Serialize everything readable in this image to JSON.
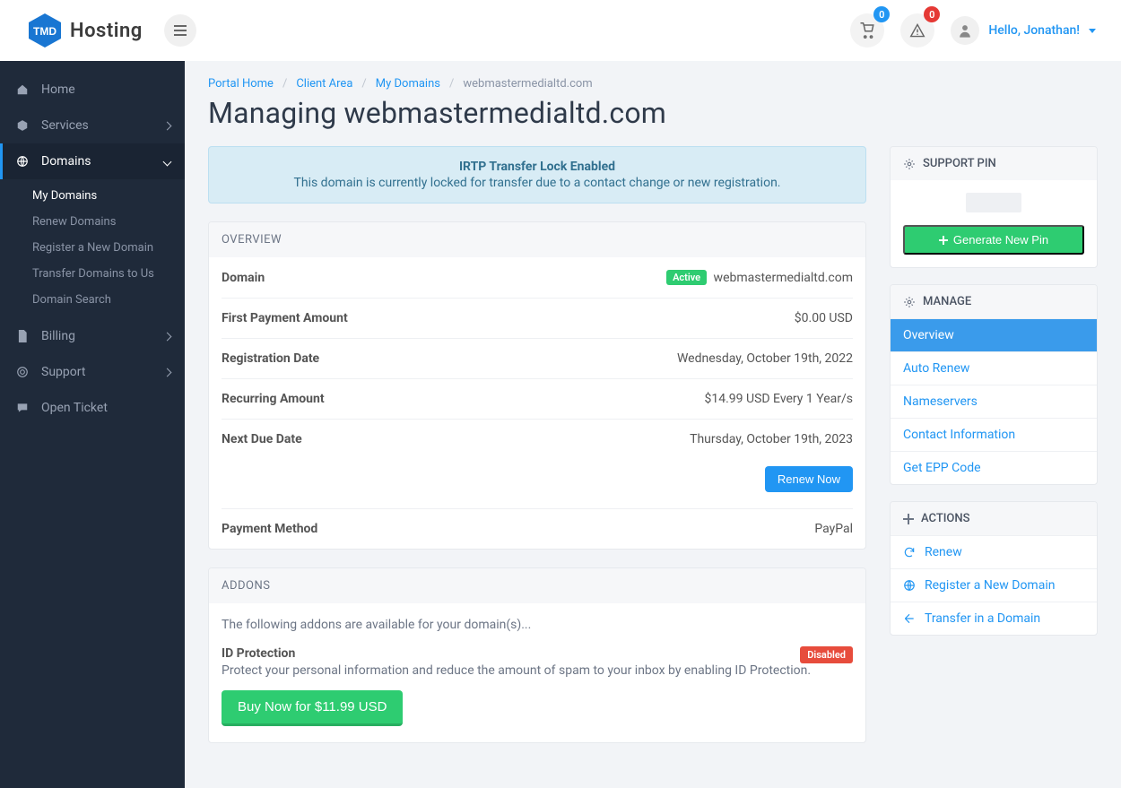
{
  "brand": {
    "name": "Hosting",
    "prefix": "TMD"
  },
  "header": {
    "cart_count": "0",
    "alert_count": "0",
    "greeting": "Hello, Jonathan!"
  },
  "sidebar": {
    "home": "Home",
    "services": "Services",
    "domains": "Domains",
    "domains_sub": {
      "my_domains": "My Domains",
      "renew": "Renew Domains",
      "register": "Register a New Domain",
      "transfer": "Transfer Domains to Us",
      "search": "Domain Search"
    },
    "billing": "Billing",
    "support": "Support",
    "open_ticket": "Open Ticket"
  },
  "breadcrumb": {
    "portal": "Portal Home",
    "client": "Client Area",
    "my_domains": "My Domains",
    "current": "webmastermedialtd.com"
  },
  "page": {
    "title": "Managing webmastermedialtd.com"
  },
  "alert": {
    "title": "IRTP Transfer Lock Enabled",
    "body": "This domain is currently locked for transfer due to a contact change or new registration."
  },
  "overview": {
    "heading": "OVERVIEW",
    "rows": {
      "domain_label": "Domain",
      "domain_status": "Active",
      "domain_value": "webmastermedialtd.com",
      "first_payment_label": "First Payment Amount",
      "first_payment_value": "$0.00 USD",
      "reg_date_label": "Registration Date",
      "reg_date_value": "Wednesday, October 19th, 2022",
      "recurring_label": "Recurring Amount",
      "recurring_value": "$14.99 USD Every 1 Year/s",
      "next_due_label": "Next Due Date",
      "next_due_value": "Thursday, October 19th, 2023",
      "renew_button": "Renew Now",
      "payment_method_label": "Payment Method",
      "payment_method_value": "PayPal"
    }
  },
  "addons": {
    "heading": "ADDONS",
    "intro": "The following addons are available for your domain(s)...",
    "item": {
      "name": "ID Protection",
      "status": "Disabled",
      "desc": "Protect your personal information and reduce the amount of spam to your inbox by enabling ID Protection.",
      "buy": "Buy Now for $11.99 USD"
    }
  },
  "side": {
    "support_pin": {
      "title": "SUPPORT PIN",
      "button": "Generate New Pin"
    },
    "manage": {
      "title": "MANAGE",
      "items": {
        "overview": "Overview",
        "auto_renew": "Auto Renew",
        "nameservers": "Nameservers",
        "contact": "Contact Information",
        "epp": "Get EPP Code"
      }
    },
    "actions": {
      "title": "ACTIONS",
      "renew": "Renew",
      "register": "Register a New Domain",
      "transfer": "Transfer in a Domain"
    }
  }
}
